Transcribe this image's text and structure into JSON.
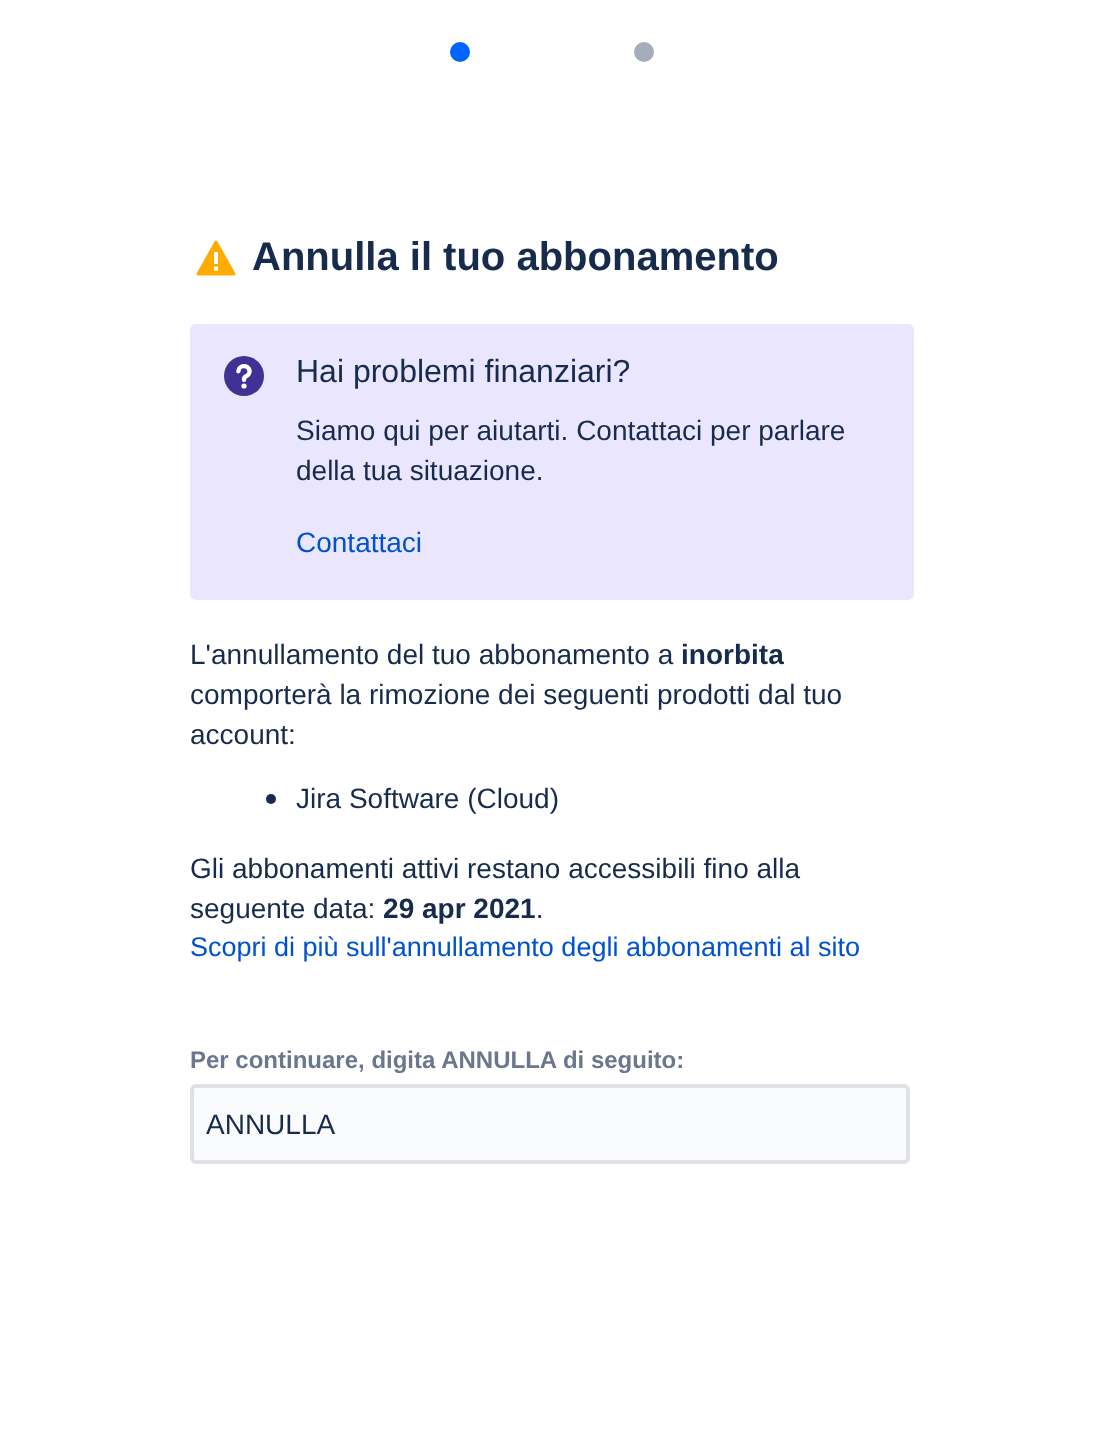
{
  "steps": [
    {
      "selected": true
    },
    {
      "selected": false
    }
  ],
  "title": "Annulla il tuo abbonamento",
  "notice": {
    "title": "Hai problemi finanziari?",
    "body": "Siamo qui per aiutarti. Contattaci per parlare della tua situazione.",
    "link": "Contattaci"
  },
  "intro": "L'annullamento del tuo abbonamento a **inorbita** comporterà la rimozione dei seguenti prodotti dal tuo account:",
  "products": [
    "Jira Software (Cloud)"
  ],
  "access_note": "Gli abbonamenti attivi restano accessibili fino alla seguente data: **29 apr 2021**.",
  "learn_more_link": "Scopri di più sull'annullamento degli abbonamenti al sito",
  "confirm_field": {
    "label": "Per continuare, digita ANNULLA di seguito:",
    "value": "ANNULLA"
  }
}
